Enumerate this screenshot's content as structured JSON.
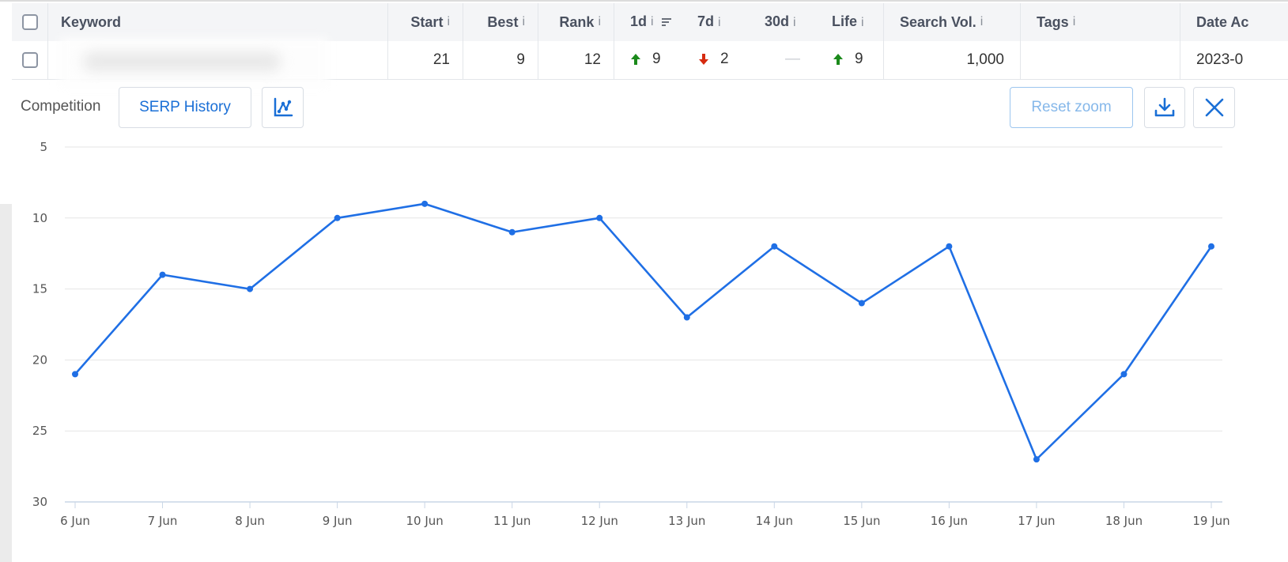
{
  "table": {
    "headers": {
      "keyword": "Keyword",
      "start": "Start",
      "best": "Best",
      "rank": "Rank",
      "d1": "1d",
      "d7": "7d",
      "d30": "30d",
      "life": "Life",
      "search_vol": "Search Vol.",
      "tags": "Tags",
      "date": "Date Ac"
    },
    "info_glyph": "i",
    "row": {
      "start": "21",
      "best": "9",
      "rank": "12",
      "d1": "9",
      "d7": "2",
      "d30": "—",
      "life": "9",
      "search_vol": "1,000",
      "tags": "",
      "date": "2023-0"
    },
    "colors": {
      "up": "#1b8a1b",
      "down": "#d62b10"
    }
  },
  "toolbar": {
    "competition_label": "Competition",
    "serp_history_label": "SERP History",
    "chart_icon": "chart-line-icon",
    "reset_zoom_label": "Reset zoom",
    "download_icon": "download-icon",
    "close_icon": "close-icon",
    "accent": "#1a6fd6"
  },
  "chart_data": {
    "type": "line",
    "categories": [
      "6 Jun",
      "7 Jun",
      "8 Jun",
      "9 Jun",
      "10 Jun",
      "11 Jun",
      "12 Jun",
      "13 Jun",
      "14 Jun",
      "15 Jun",
      "16 Jun",
      "17 Jun",
      "18 Jun",
      "19 Jun"
    ],
    "series": [
      {
        "values": [
          21,
          14,
          15,
          10,
          9,
          11,
          10,
          17,
          12,
          16,
          12,
          27,
          21,
          12
        ]
      }
    ],
    "y_ticks": [
      5,
      10,
      15,
      20,
      25,
      30
    ],
    "ylim": [
      5,
      30
    ],
    "y_reversed": true,
    "grid": true,
    "line_color": "#1f6fe5"
  }
}
